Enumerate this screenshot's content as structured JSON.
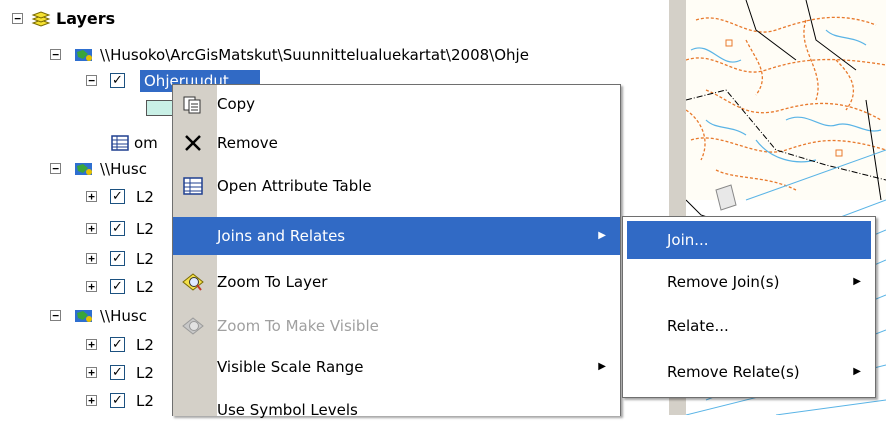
{
  "toc": {
    "layers_title": "Layers",
    "group1_path": "\\\\Husoko\\ArcGisMatskut\\Suunnittelualuekartat\\2008\\Ohje",
    "selected_layer": "Ohjeruudut",
    "table_label": "om",
    "group2_label": "\\\\Husc",
    "group3_label": "\\\\Husc",
    "layer_items": [
      "L2",
      "L2",
      "L2",
      "L2",
      "L2",
      "L2",
      "L2"
    ]
  },
  "context_menu": {
    "items": [
      {
        "label": "Copy",
        "accel": "C"
      },
      {
        "label": "Remove",
        "accel": "R"
      },
      {
        "label": "Open Attribute Table",
        "accel": "T"
      },
      {
        "label": "Joins and Relates",
        "accel": "J",
        "has_submenu": true,
        "highlighted": true
      },
      {
        "label": "Zoom To Layer",
        "accel": "Z"
      },
      {
        "label": "Zoom To Make Visible",
        "accel": "M",
        "disabled": true
      },
      {
        "label": "Visible Scale Range",
        "accel": "V",
        "has_submenu": true
      },
      {
        "label": "Use Symbol Levels",
        "accel": ""
      }
    ]
  },
  "submenu": {
    "items": [
      {
        "label": "Join...",
        "highlighted": true
      },
      {
        "label": "Remove Join(s)",
        "has_submenu": true
      },
      {
        "label": "Relate..."
      },
      {
        "label": "Remove Relate(s)",
        "has_submenu": true
      }
    ]
  },
  "colors": {
    "highlight": "#316ac5",
    "menu_strip": "#d4d0c8",
    "map_orange": "#e8792c",
    "map_cyan": "#5ab4e6"
  }
}
